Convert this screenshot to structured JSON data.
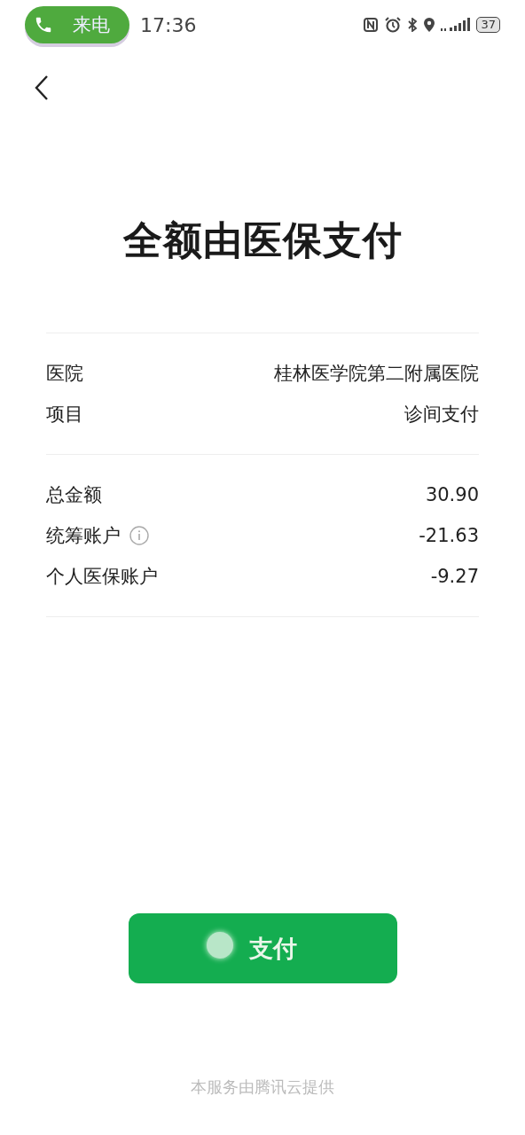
{
  "status_bar": {
    "call_pill": "来电",
    "time": "17:36",
    "battery": "37"
  },
  "title": "全额由医保支付",
  "sections": [
    {
      "rows": [
        {
          "label": "医院",
          "value": "桂林医学院第二附属医院",
          "info": false
        },
        {
          "label": "项目",
          "value": "诊间支付",
          "info": false
        }
      ]
    },
    {
      "rows": [
        {
          "label": "总金额",
          "value": "30.90",
          "info": false
        },
        {
          "label": "统筹账户",
          "value": "-21.63",
          "info": true
        },
        {
          "label": "个人医保账户",
          "value": "-9.27",
          "info": false
        }
      ]
    }
  ],
  "pay_button": "支付",
  "footer": "本服务由腾讯云提供"
}
